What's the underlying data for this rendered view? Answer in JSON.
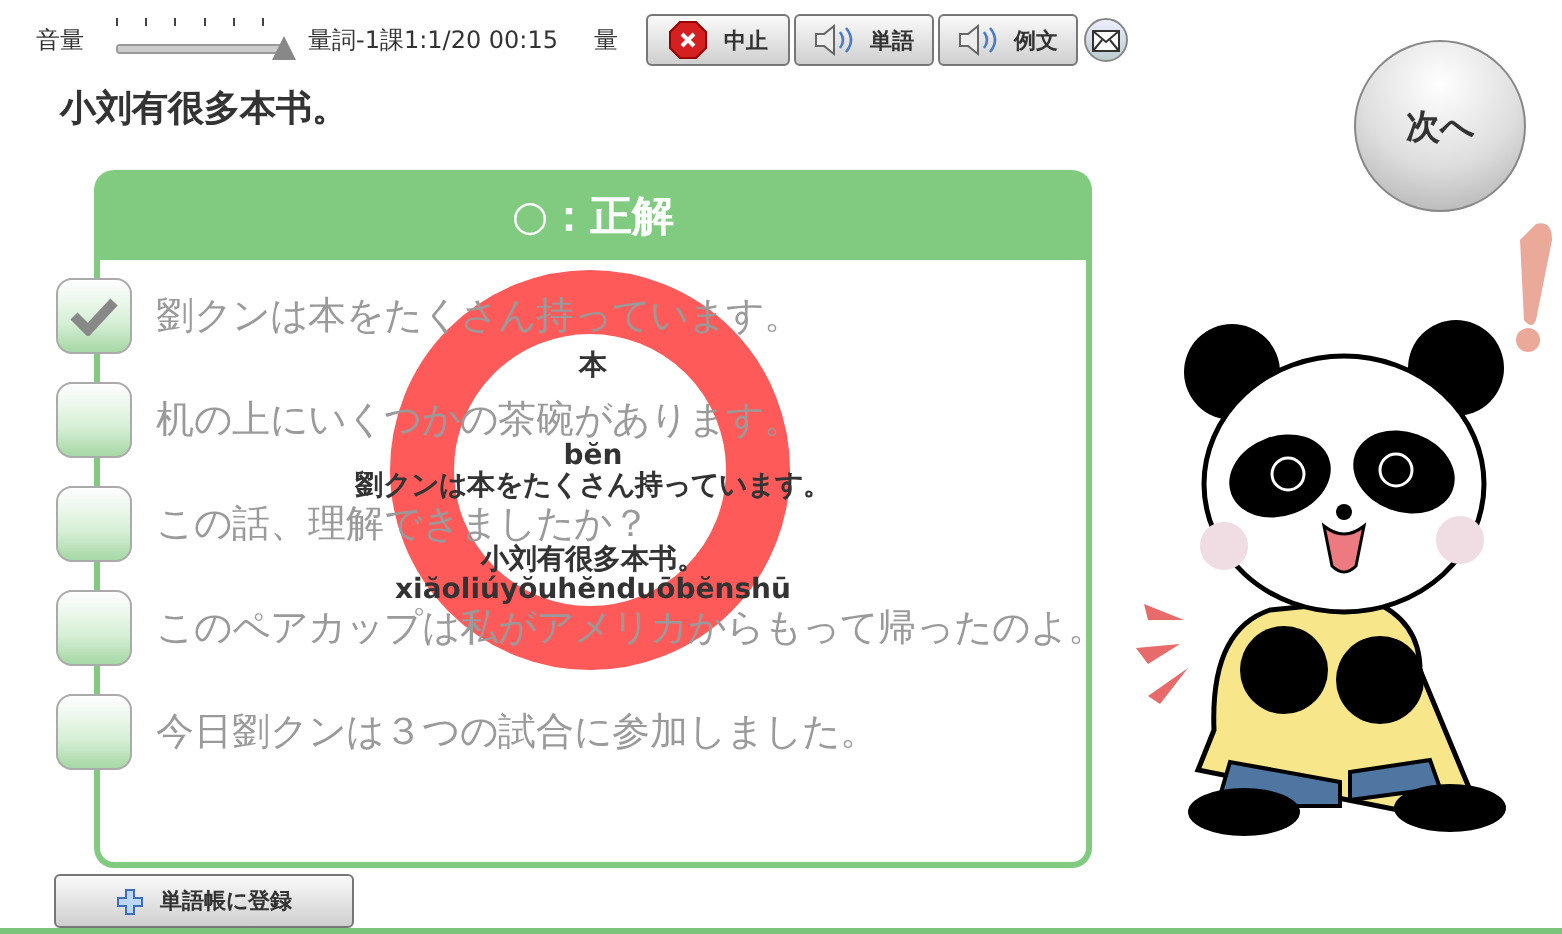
{
  "toolbar": {
    "volume": {
      "label": "音量",
      "level": 1
    },
    "lesson_info": "量詞-1課1:1/20 00:15",
    "category": "量",
    "buttons": [
      {
        "kind": "stop",
        "label": "中止"
      },
      {
        "kind": "sound",
        "label": "単語"
      },
      {
        "kind": "sound",
        "label": "例文"
      },
      {
        "kind": "mail"
      }
    ]
  },
  "question": "小刘有很多本书。",
  "next_button": "次へ",
  "choices": [
    {
      "text": "劉クンは本をたくさん持っています。",
      "checked": true
    },
    {
      "text": "机の上にいくつかの茶碗があります。",
      "checked": false
    },
    {
      "text": "この話、理解できましたか？",
      "checked": false
    },
    {
      "text": "このペアカップは私がアメリカからもって帰ったのよ。",
      "checked": false
    },
    {
      "text": "今日劉クンは３つの試合に参加しました。",
      "checked": false
    }
  ],
  "result": {
    "title": "○：正解",
    "correct": true,
    "word": "本",
    "word_pinyin": "bĕn",
    "translation": "劉クンは本をたくさん持っています。",
    "sentence": "小刘有很多本书。",
    "sentence_pinyin": "xiăoliúyŏuhĕnduōbĕnshū"
  },
  "add_button": "単語帳に登録"
}
